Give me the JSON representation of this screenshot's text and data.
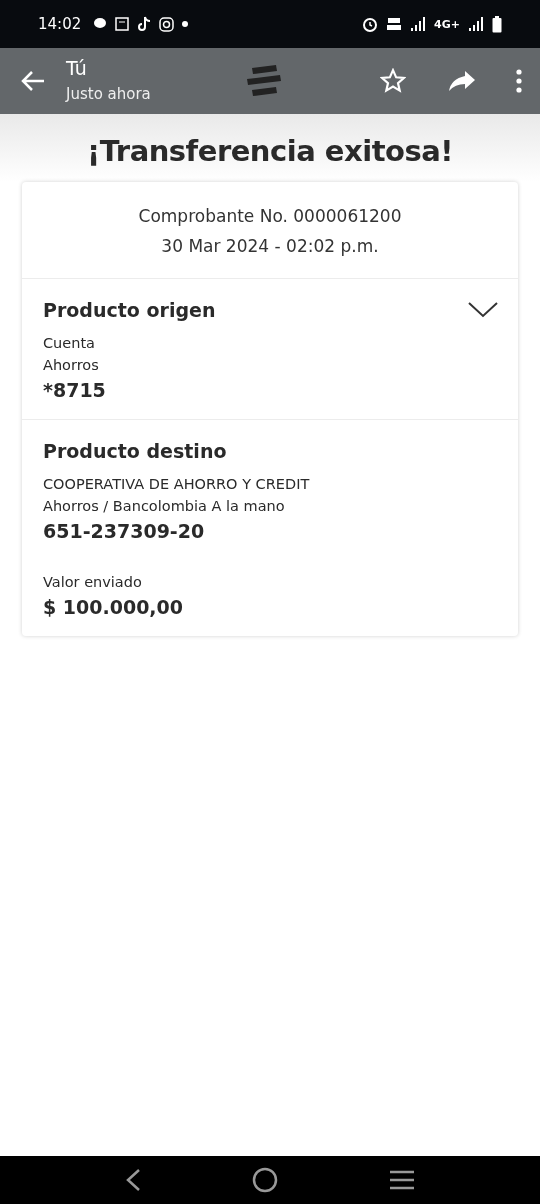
{
  "status_bar": {
    "time": "14:02",
    "network": "4G+"
  },
  "header": {
    "title": "Tú",
    "subtitle": "Justo ahora"
  },
  "heading": "¡Transferencia exitosa!",
  "receipt": {
    "number": "Comprobante No. 0000061200",
    "date": "30 Mar 2024 - 02:02 p.m."
  },
  "sections": [
    {
      "title": "Producto origen",
      "kind": "collapsible",
      "groups": [
        {
          "lines": [
            {
              "text": "Cuenta",
              "kind": "label"
            },
            {
              "text": "Ahorros",
              "kind": "label"
            },
            {
              "text": "*8715",
              "kind": "value"
            }
          ]
        }
      ]
    },
    {
      "title": "Producto destino",
      "kind": "plain",
      "groups": [
        {
          "lines": [
            {
              "text": "COOPERATIVA DE AHORRO Y CREDIT",
              "kind": "label"
            },
            {
              "text": "Ahorros / Bancolombia A la mano",
              "kind": "label"
            },
            {
              "text": "651-237309-20",
              "kind": "value"
            }
          ]
        },
        {
          "lines": [
            {
              "text": "Valor enviado",
              "kind": "label"
            },
            {
              "text": "$ 100.000,00",
              "kind": "value"
            }
          ]
        }
      ]
    }
  ]
}
